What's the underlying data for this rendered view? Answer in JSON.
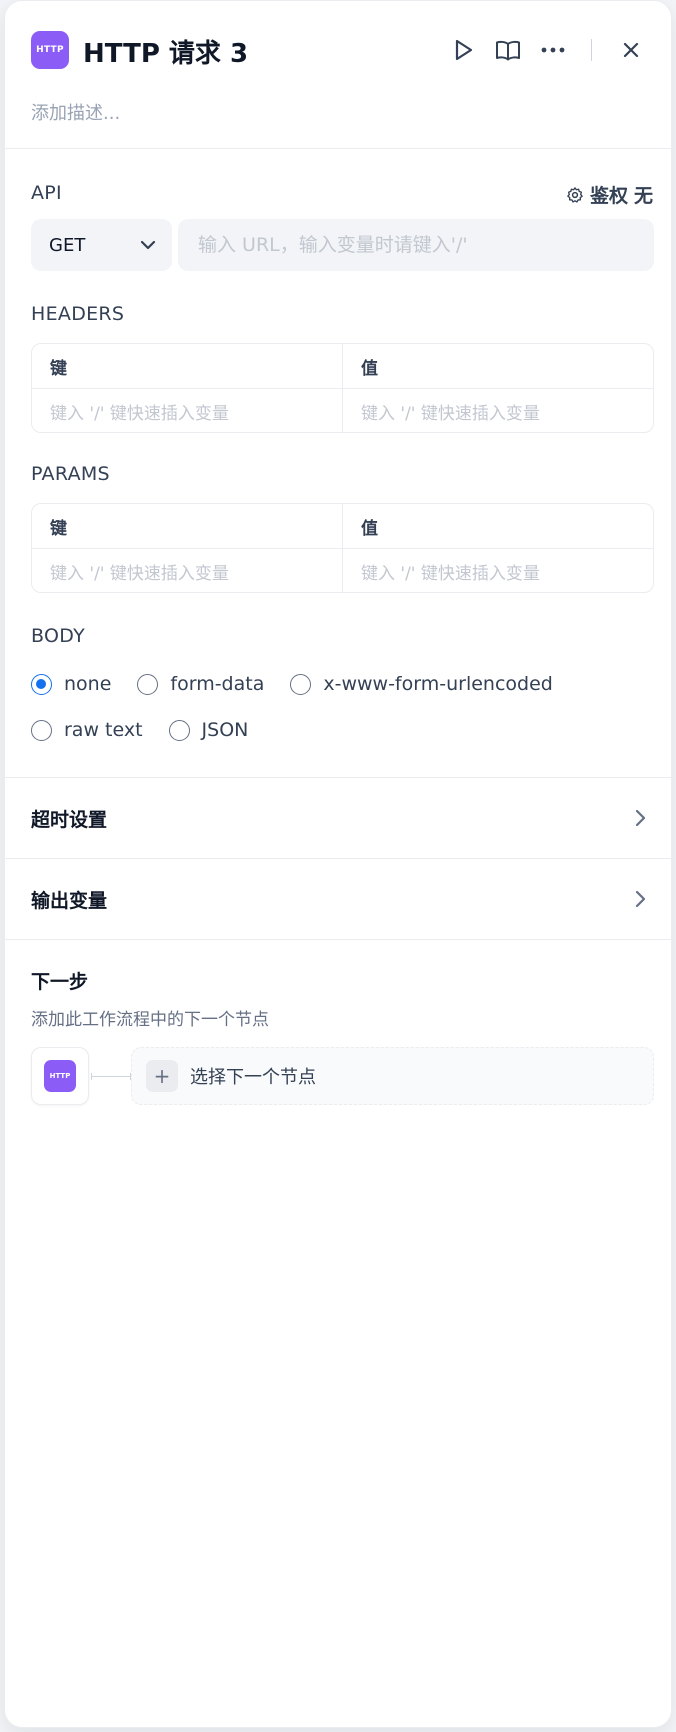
{
  "header": {
    "node_badge": "HTTP",
    "title": "HTTP 请求 3",
    "description_placeholder": "添加描述..."
  },
  "api": {
    "label": "API",
    "auth_label": "鉴权",
    "auth_value": "无",
    "method": "GET",
    "url_placeholder": "输入 URL，输入变量时请键入'/'",
    "url_value": ""
  },
  "headers": {
    "label": "HEADERS",
    "columns": [
      "键",
      "值"
    ],
    "placeholders": [
      "键入 '/' 键快速插入变量",
      "键入 '/' 键快速插入变量"
    ]
  },
  "params": {
    "label": "PARAMS",
    "columns": [
      "键",
      "值"
    ],
    "placeholders": [
      "键入 '/' 键快速插入变量",
      "键入 '/' 键快速插入变量"
    ]
  },
  "body": {
    "label": "BODY",
    "options": [
      "none",
      "form-data",
      "x-www-form-urlencoded",
      "raw text",
      "JSON"
    ],
    "selected": "none"
  },
  "timeout": {
    "label": "超时设置"
  },
  "output_vars": {
    "label": "输出变量"
  },
  "next_step": {
    "title": "下一步",
    "description": "添加此工作流程中的下一个节点",
    "node_badge": "HTTP",
    "select_label": "选择下一个节点"
  },
  "colors": {
    "brand_purple": "#8b5cf6",
    "radio_selected": "#1570ef"
  }
}
